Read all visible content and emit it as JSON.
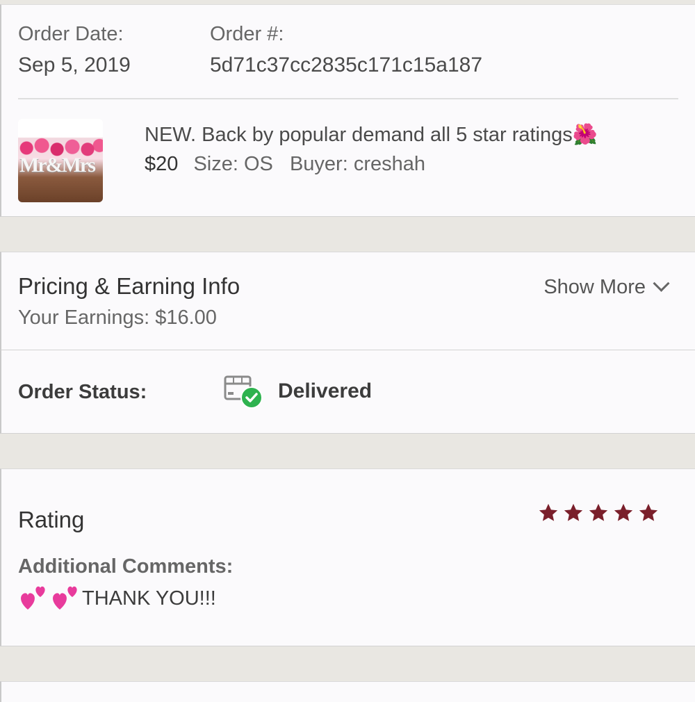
{
  "order": {
    "date_label": "Order Date:",
    "date_value": "Sep 5, 2019",
    "number_label": "Order #:",
    "number_value": "5d71c37cc2835c171c15a187"
  },
  "item": {
    "thumb_text": "Mr&Mrs",
    "title": "NEW. Back by popular demand all 5 star ratings🌺",
    "price": "$20",
    "size": "Size: OS",
    "buyer": "Buyer: creshah"
  },
  "pricing": {
    "heading": "Pricing & Earning Info",
    "earnings": "Your Earnings: $16.00",
    "show_more": "Show More"
  },
  "status": {
    "label": "Order Status:",
    "value": "Delivered",
    "icon": "package-check-icon",
    "check_color": "#2eb24f"
  },
  "rating": {
    "heading": "Rating",
    "stars_filled": 5,
    "stars_total": 5,
    "star_color": "#7a1f2b",
    "comments_label": "Additional Comments:",
    "comment_text": "THANK YOU!!!",
    "heart_color": "#e83b9c"
  }
}
